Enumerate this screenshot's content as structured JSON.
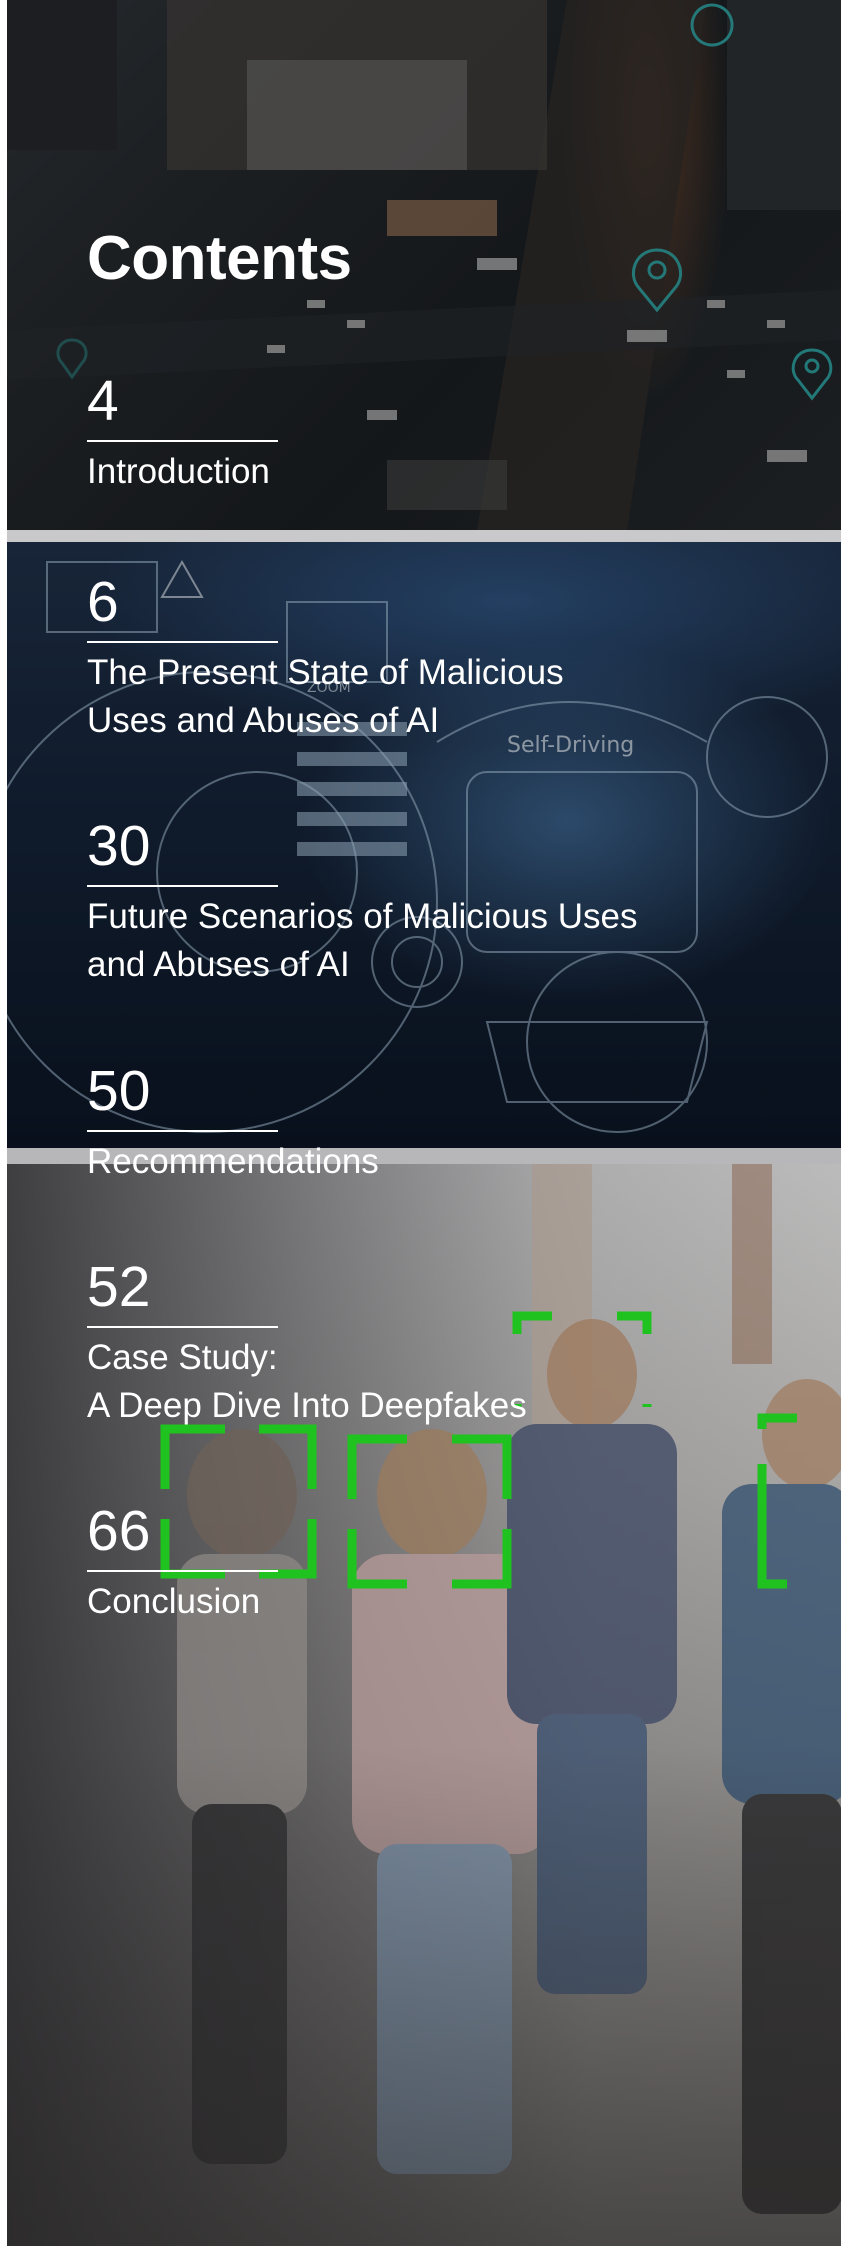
{
  "title": "Contents",
  "entries": [
    {
      "page": "4",
      "lines": [
        "Introduction"
      ]
    },
    {
      "page": "6",
      "lines": [
        "The Present State of Malicious",
        "Uses and Abuses of AI"
      ]
    },
    {
      "page": "30",
      "lines": [
        "Future Scenarios of Malicious Uses",
        "and Abuses of AI"
      ]
    },
    {
      "page": "50",
      "lines": [
        "Recommendations"
      ]
    },
    {
      "page": "52",
      "lines": [
        "Case Study:",
        "A Deep Dive Into Deepfakes"
      ]
    },
    {
      "page": "66",
      "lines": [
        "Conclusion"
      ]
    }
  ],
  "decor": {
    "car_panel_text": "Self-Driving",
    "car_panel_zoom": "ZOOM",
    "colors": {
      "text": "#ffffff",
      "face_box": "#1fc21f",
      "map_pin": "#39c9c9"
    }
  }
}
